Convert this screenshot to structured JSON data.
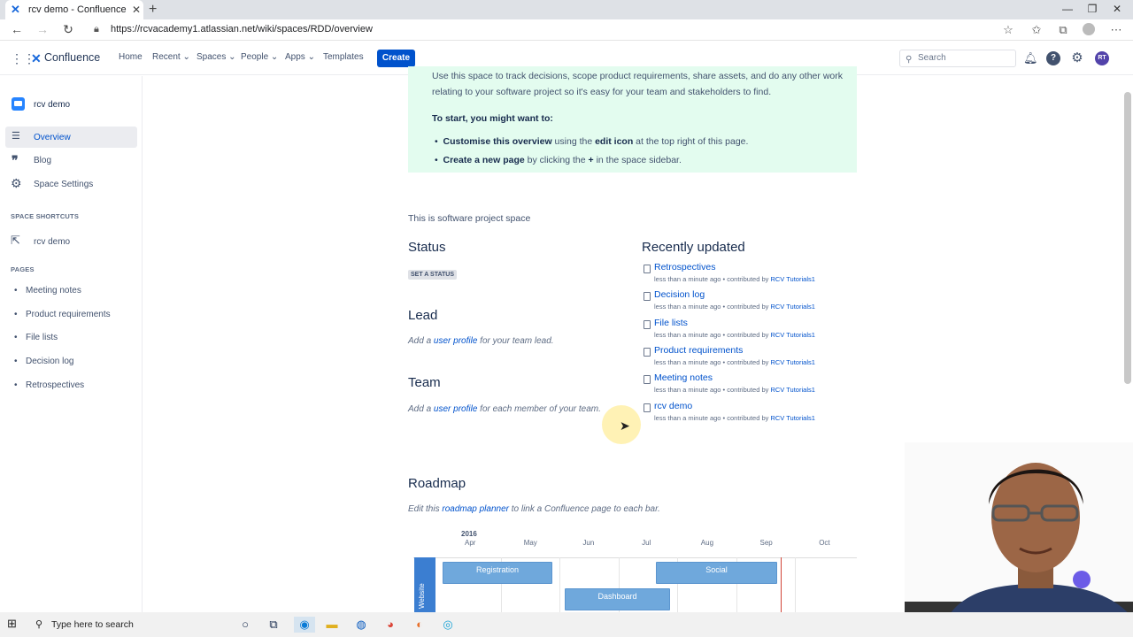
{
  "browser": {
    "tab_title": "rcv demo - Confluence",
    "new_tab": "+",
    "url": "https://rcvacademy1.atlassian.net/wiki/spaces/RDD/overview"
  },
  "header": {
    "logo": "Confluence",
    "nav": [
      "Home",
      "Recent",
      "Spaces",
      "People",
      "Apps",
      "Templates"
    ],
    "create": "Create",
    "search_placeholder": "Search",
    "help": "?",
    "user_initials": "RT"
  },
  "sidebar": {
    "space_name": "rcv demo",
    "items": [
      {
        "label": "Overview",
        "icon": "lines-icon"
      },
      {
        "label": "Blog",
        "icon": "quote-icon"
      },
      {
        "label": "Space Settings",
        "icon": "gear-icon"
      }
    ],
    "shortcuts_heading": "SPACE SHORTCUTS",
    "shortcut": "rcv demo",
    "pages_heading": "PAGES",
    "pages": [
      "Meeting notes",
      "Product requirements",
      "File lists",
      "Decision log",
      "Retrospectives"
    ]
  },
  "main": {
    "banner_line1": "Use this space to track decisions, scope product requirements, share assets, and do any other work",
    "banner_line2": "relating to your software project so it's easy for your team and stakeholders to find.",
    "start_heading": "To start, you might want to:",
    "tip1_bold": "Customise this overview",
    "tip1_a": " using the ",
    "tip1_bold2": "edit icon",
    "tip1_b": " at the top right of this page.",
    "tip2_bold": "Create a new page",
    "tip2_a": " by clicking the ",
    "tip2_bold2": "+",
    "tip2_b": " in the space sidebar.",
    "description": "This is software project space",
    "status_heading": "Status",
    "set_status": "SET A STATUS",
    "lead_heading": "Lead",
    "lead_pre": "Add a ",
    "lead_link": "user profile",
    "lead_post": " for your team lead.",
    "team_heading": "Team",
    "team_pre": "Add a ",
    "team_link": "user profile",
    "team_post": " for each member of your team.",
    "recent_heading": "Recently updated",
    "recent": [
      {
        "title": "Retrospectives",
        "meta": "less than a minute ago • contributed by ",
        "user": "RCV Tutorials1"
      },
      {
        "title": "Decision log",
        "meta": "less than a minute ago • contributed by ",
        "user": "RCV Tutorials1"
      },
      {
        "title": "File lists",
        "meta": "less than a minute ago • contributed by ",
        "user": "RCV Tutorials1"
      },
      {
        "title": "Product requirements",
        "meta": "less than a minute ago • contributed by ",
        "user": "RCV Tutorials1"
      },
      {
        "title": "Meeting notes",
        "meta": "less than a minute ago • contributed by ",
        "user": "RCV Tutorials1"
      },
      {
        "title": "rcv demo",
        "meta": "less than a minute ago • contributed by ",
        "user": "RCV Tutorials1"
      }
    ],
    "roadmap_heading": "Roadmap",
    "roadmap_pre": "Edit this ",
    "roadmap_link": "roadmap planner",
    "roadmap_post": " to link a Confluence page to each bar.",
    "roadmap_year": "2016",
    "roadmap_months": [
      "Apr",
      "May",
      "Jun",
      "Jul",
      "Aug",
      "Sep",
      "Oct"
    ],
    "roadmap_lane": "Website",
    "roadmap_bars": [
      "Registration",
      "Social",
      "Dashboard"
    ]
  },
  "taskbar": {
    "search_placeholder": "Type here to search"
  }
}
